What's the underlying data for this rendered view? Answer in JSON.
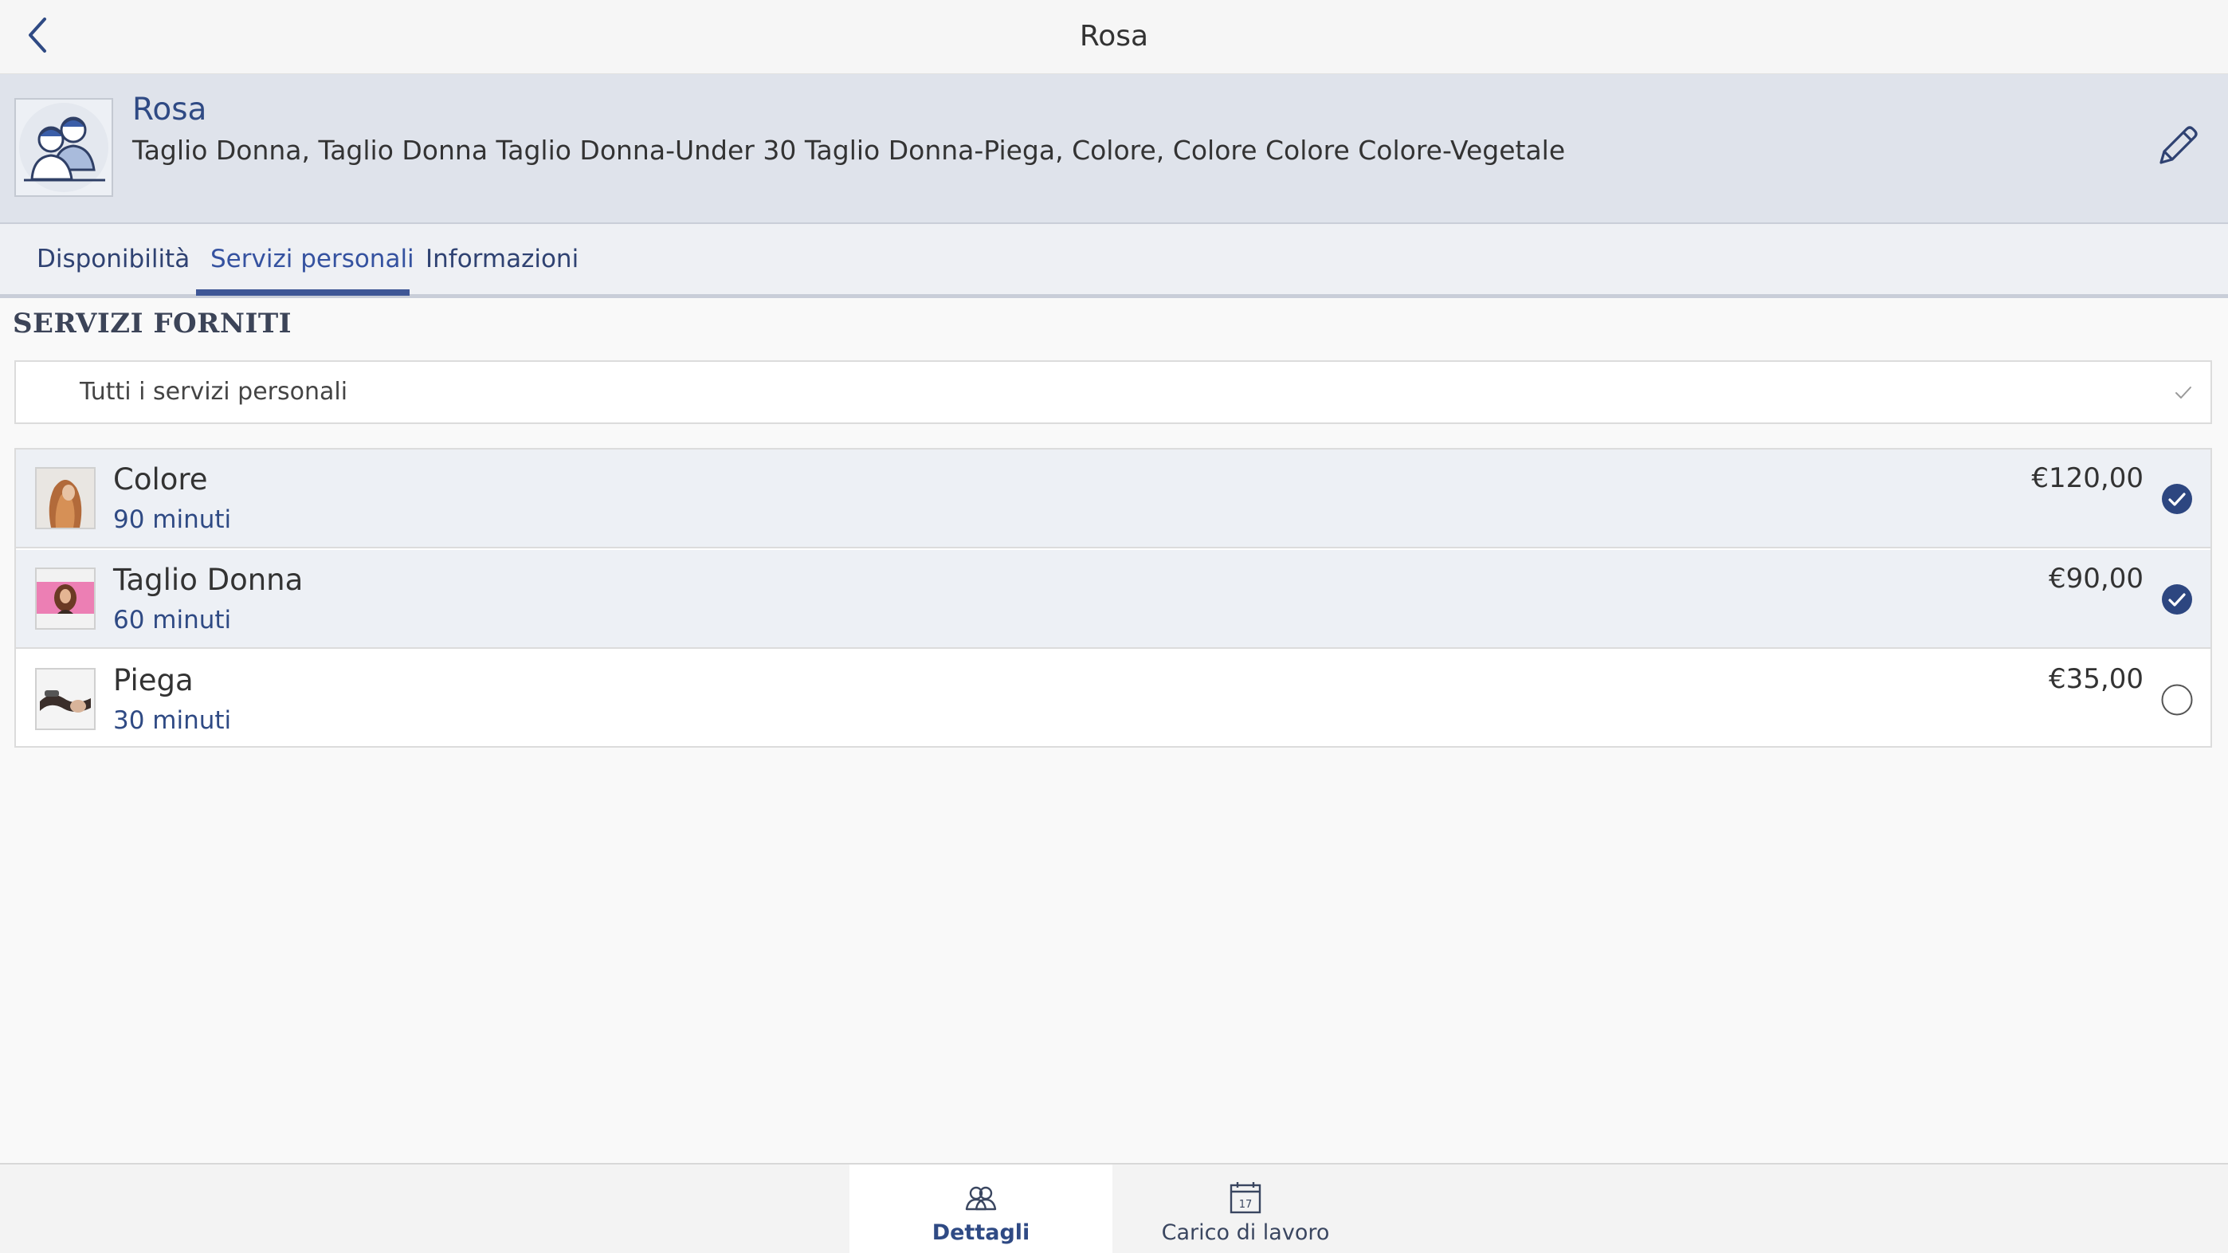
{
  "navbar": {
    "title": "Rosa",
    "back_icon": "chevron-left-icon"
  },
  "profile": {
    "name": "Rosa",
    "services_summary": "Taglio Donna, Taglio Donna Taglio Donna-Under 30 Taglio Donna-Piega, Colore, Colore Colore Colore-Vegetale",
    "avatar_icon": "staff-avatar-icon",
    "edit_icon": "pencil-icon"
  },
  "tabs": [
    {
      "label": "Disponibilità",
      "active": false
    },
    {
      "label": "Servizi personali",
      "active": true
    },
    {
      "label": "Informazioni",
      "active": false
    }
  ],
  "section": {
    "title": "SERVIZI FORNITI",
    "all_services_label": "Tutti i servizi personali"
  },
  "services": [
    {
      "name": "Colore",
      "duration": "90 minuti",
      "price": "€120,00",
      "selected": true
    },
    {
      "name": "Taglio Donna",
      "duration": "60 minuti",
      "price": "€90,00",
      "selected": true
    },
    {
      "name": "Piega",
      "duration": "30 minuti",
      "price": "€35,00",
      "selected": false
    }
  ],
  "bottom_bar": [
    {
      "label": "Dettagli",
      "icon": "people-icon",
      "active": true
    },
    {
      "label": "Carico di lavoro",
      "icon": "calendar-icon",
      "active": false,
      "icon_text": "17"
    }
  ],
  "colors": {
    "accent": "#2f4a84",
    "header_bg": "#dfe3eb",
    "selected_row_bg": "#edf0f5",
    "check_fill": "#2d4680"
  }
}
